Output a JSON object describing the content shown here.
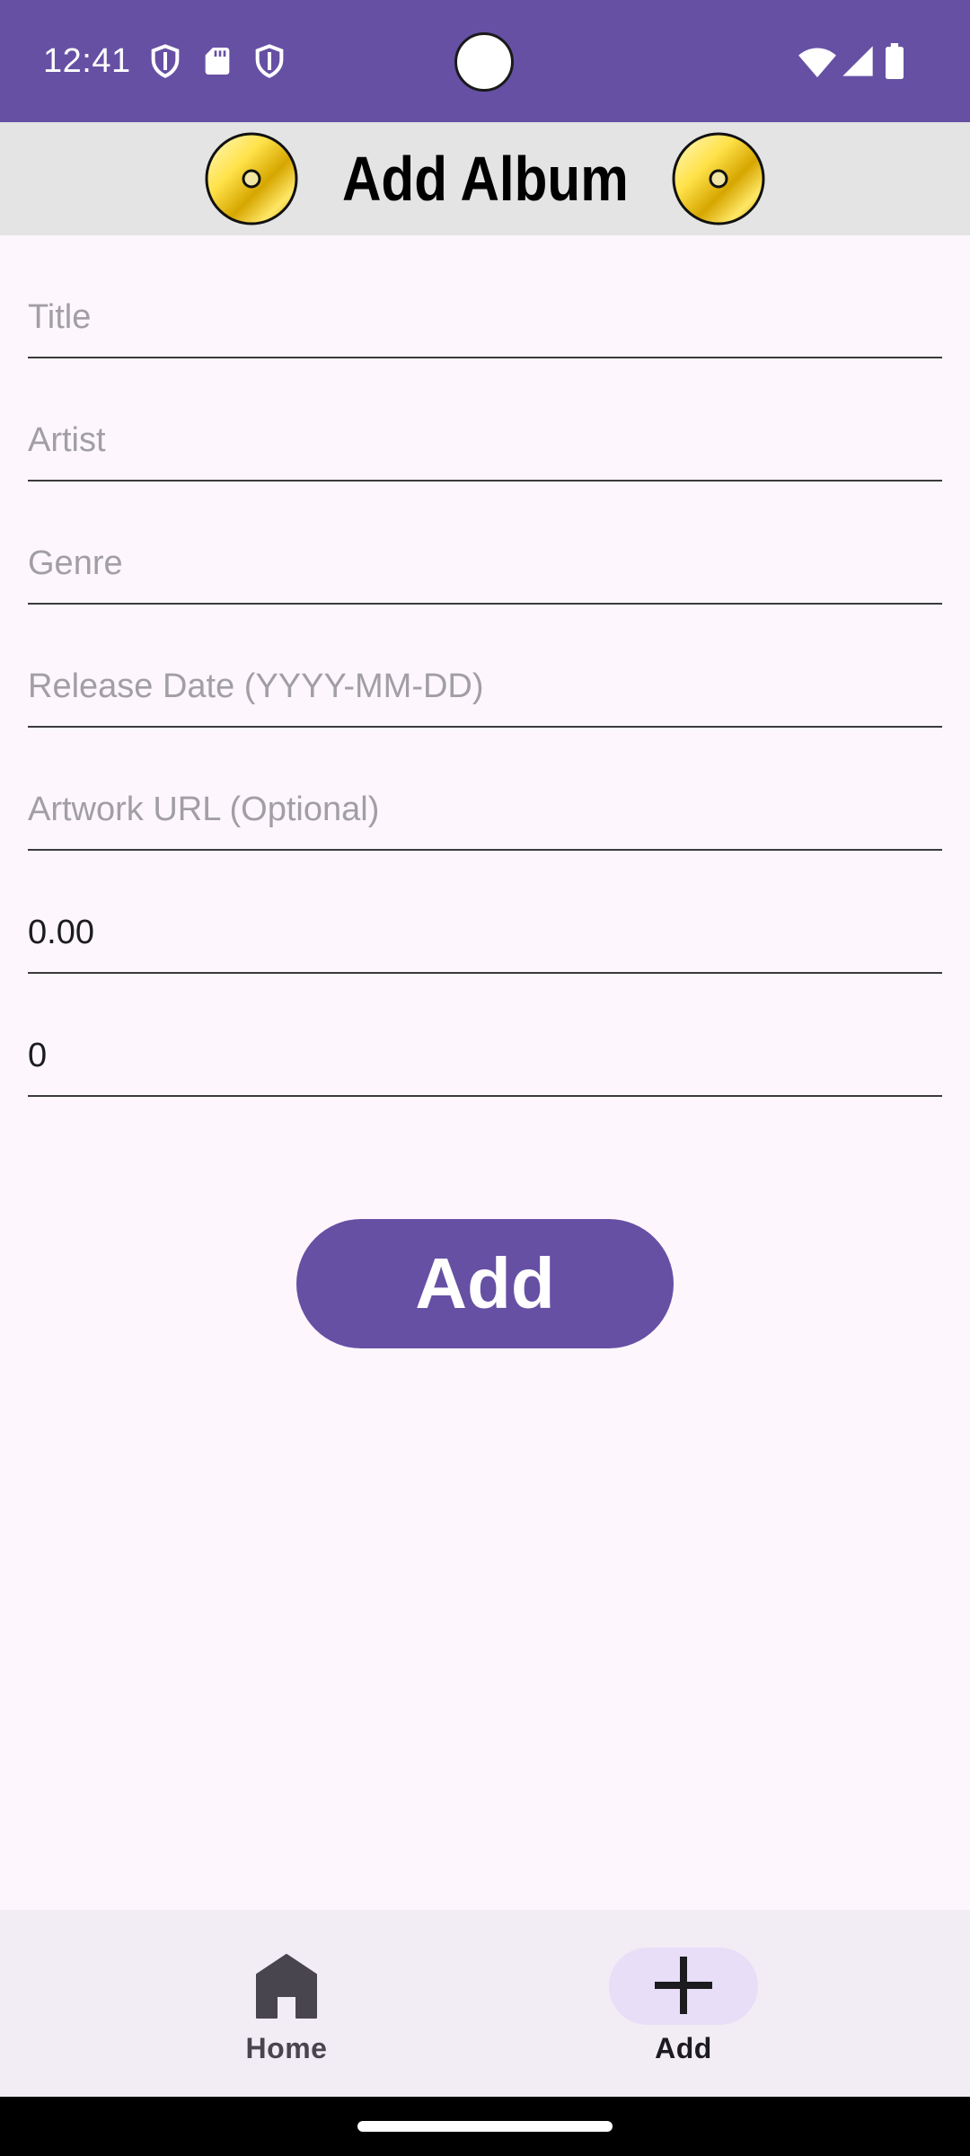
{
  "status_bar": {
    "time": "12:41",
    "left_icons": [
      "shield-icon",
      "sd-card-icon",
      "shield-icon"
    ],
    "right_icons": [
      "wifi-icon",
      "cellular-signal-icon",
      "battery-icon"
    ],
    "background_color": "#6650A4"
  },
  "header": {
    "title": "Add Album",
    "decor_icons": [
      "cd-disc-icon",
      "cd-disc-icon"
    ],
    "background_color": "#E4E4E4"
  },
  "form": {
    "fields": [
      {
        "name": "title",
        "placeholder": "Title",
        "value": ""
      },
      {
        "name": "artist",
        "placeholder": "Artist",
        "value": ""
      },
      {
        "name": "genre",
        "placeholder": "Genre",
        "value": ""
      },
      {
        "name": "release_date",
        "placeholder": "Release Date (YYYY-MM-DD)",
        "value": ""
      },
      {
        "name": "artwork_url",
        "placeholder": "Artwork URL (Optional)",
        "value": ""
      },
      {
        "name": "price",
        "placeholder": "",
        "value": "0.00"
      },
      {
        "name": "stock",
        "placeholder": "",
        "value": "0"
      }
    ],
    "submit_label": "Add",
    "accent_color": "#6650A4"
  },
  "bottom_nav": {
    "items": [
      {
        "label": "Home",
        "icon": "home-icon",
        "selected": false
      },
      {
        "label": "Add",
        "icon": "plus-icon",
        "selected": true
      }
    ],
    "selected_indicator_color": "#E8DEF8"
  }
}
